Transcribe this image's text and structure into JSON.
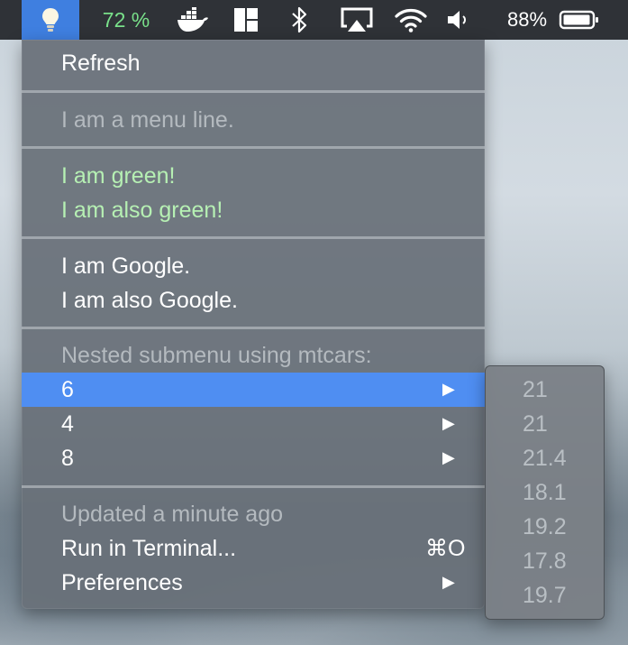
{
  "menubar": {
    "cpu_text": "72 %",
    "battery_pct": "88%",
    "icons": [
      "lightbulb-icon",
      "docker-icon",
      "mosaic-icon",
      "bluetooth-icon",
      "airplay-icon",
      "wifi-icon",
      "volume-icon",
      "battery-icon"
    ]
  },
  "menu": {
    "refresh": "Refresh",
    "menu_line": "I am a menu line.",
    "green_1": "I am green!",
    "green_2": "I am also green!",
    "google_1": "I am Google.",
    "google_2": "I am also Google.",
    "submenu_header": "Nested submenu using mtcars:",
    "cyl_items": [
      "6",
      "4",
      "8"
    ],
    "arrow": "▶",
    "updated": "Updated a minute ago",
    "run_in_terminal": "Run in Terminal...",
    "run_shortcut": "⌘O",
    "preferences": "Preferences"
  },
  "submenu": {
    "values": [
      "21",
      "21",
      "21.4",
      "18.1",
      "19.2",
      "17.8",
      "19.7"
    ]
  },
  "colors": {
    "highlight": "#4f8ef2",
    "green_text": "#b6f0b3",
    "cpu_green": "#79e08a",
    "menubar_bg": "#2f3237"
  }
}
